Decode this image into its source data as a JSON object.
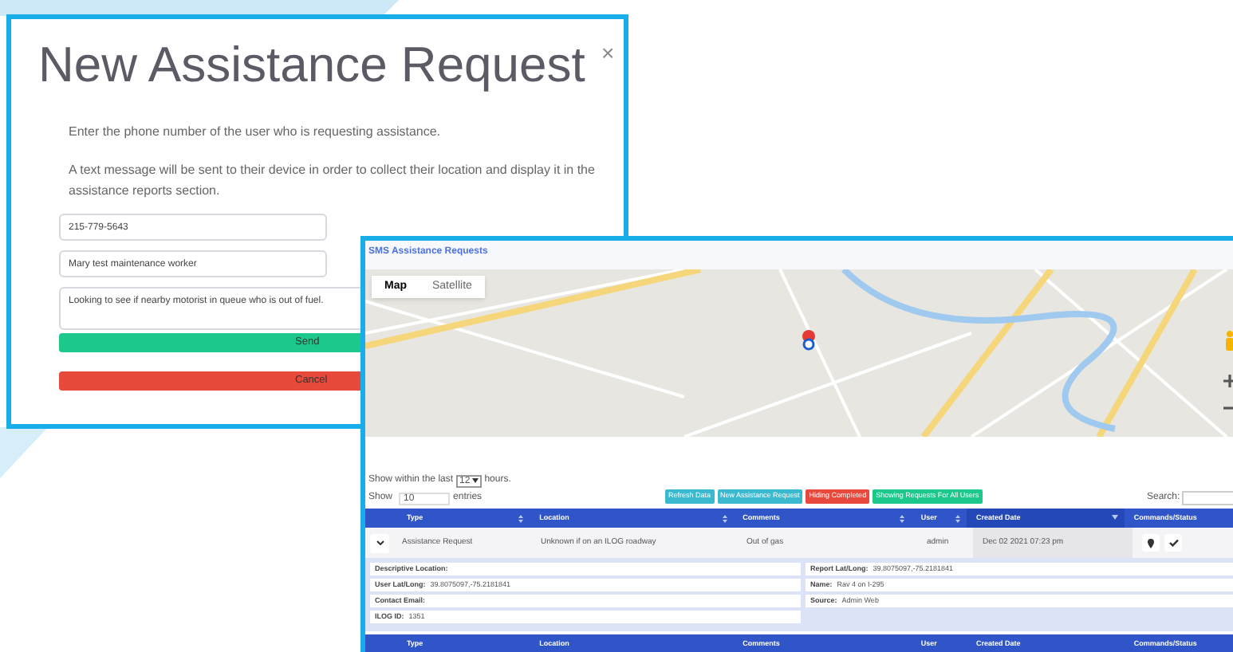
{
  "modal": {
    "title": "New Assistance Request",
    "close": "×",
    "instructions": [
      "Enter the phone number of the user who is requesting assistance.",
      "A text message will be sent to their device in order to collect their location and display it in the assistance reports section."
    ],
    "fields": [
      {
        "kind": "input",
        "value": "215-779-5643"
      },
      {
        "kind": "input",
        "value": "Mary test maintenance worker"
      },
      {
        "kind": "textarea",
        "value": "Looking to see if nearby motorist in queue who is out of fuel."
      }
    ],
    "buttons": [
      {
        "label": "Send",
        "kind": "success"
      },
      {
        "label": "Cancel",
        "kind": "danger"
      }
    ]
  },
  "panel": {
    "title": "SMS Assistance Requests",
    "map": {
      "tabs": [
        {
          "label": "Map",
          "selected": true
        },
        {
          "label": "Satellite",
          "selected": false
        }
      ]
    },
    "hours_filter": {
      "prefix": "Show within the last",
      "value": "12",
      "suffix": "hours."
    },
    "page_length": {
      "prefix": "Show",
      "value": "10",
      "suffix": "entries"
    },
    "actions": [
      {
        "label": "Refresh Data",
        "color": "#3bb9cf"
      },
      {
        "label": "New Assistance Request",
        "color": "#3bb9cf"
      },
      {
        "label": "Hiding Completed",
        "color": "#e8493c"
      },
      {
        "label": "Showing Requests For All Users",
        "color": "#1cc88a"
      }
    ],
    "search": {
      "label": "Search:"
    },
    "table": {
      "columns": [
        {
          "label": "Type",
          "sortable": true,
          "sorted": false
        },
        {
          "label": "Location",
          "sortable": true,
          "sorted": false
        },
        {
          "label": "Comments",
          "sortable": true,
          "sorted": false
        },
        {
          "label": "User",
          "sortable": true,
          "sorted": false
        },
        {
          "label": "Created Date",
          "sortable": true,
          "sorted": true
        },
        {
          "label": "Commands/Status",
          "sortable": false,
          "sorted": false
        }
      ],
      "rows": [
        {
          "expanded": true,
          "cells": [
            "Assistance Request",
            "Unknown if on an ILOG roadway",
            "Out of gas",
            "admin",
            "Dec 02 2021 07:23 pm"
          ],
          "details_left": [
            {
              "label": "Descriptive Location:"
            },
            {
              "label": "User Lat/Long:",
              "value": "39.8075097,-75.2181841"
            },
            {
              "label": "Contact Email:"
            },
            {
              "label": "ILOG ID:",
              "value": "1351"
            }
          ],
          "details_right": [
            {
              "label": "Report Lat/Long:",
              "value": "39.8075097,-75.2181841"
            },
            {
              "label": "Name:",
              "value": "Rav 4 on I-295"
            },
            {
              "label": "Source:",
              "value": "Admin Web"
            }
          ]
        }
      ],
      "footer_columns": [
        "Type",
        "Location",
        "Comments",
        "User",
        "Created Date",
        "Commands/Status"
      ]
    }
  }
}
